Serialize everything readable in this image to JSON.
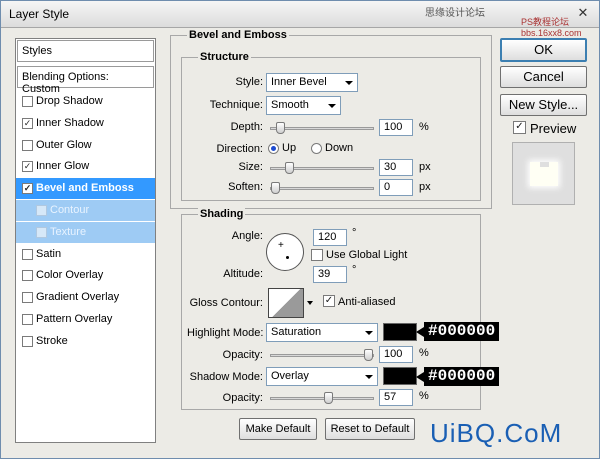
{
  "window": {
    "title": "Layer Style",
    "watermark_top": "思缘设计论坛",
    "watermark_top2": "PS教程论坛 bbs.16xx8.com",
    "watermark_bottom": "UiBQ.CoM"
  },
  "styles_panel": {
    "header": "Styles",
    "blending_options": "Blending Options: Custom",
    "items": [
      {
        "label": "Drop Shadow",
        "checked": false
      },
      {
        "label": "Inner Shadow",
        "checked": true
      },
      {
        "label": "Outer Glow",
        "checked": false
      },
      {
        "label": "Inner Glow",
        "checked": true
      },
      {
        "label": "Bevel and Emboss",
        "checked": true,
        "selected": true
      },
      {
        "label": "Contour",
        "checked": false,
        "sub": true
      },
      {
        "label": "Texture",
        "checked": false,
        "sub": true
      },
      {
        "label": "Satin",
        "checked": false
      },
      {
        "label": "Color Overlay",
        "checked": false
      },
      {
        "label": "Gradient Overlay",
        "checked": false
      },
      {
        "label": "Pattern Overlay",
        "checked": false
      },
      {
        "label": "Stroke",
        "checked": false
      }
    ]
  },
  "bevel": {
    "group_title": "Bevel and Emboss",
    "structure": {
      "title": "Structure",
      "style_label": "Style:",
      "style_value": "Inner Bevel",
      "technique_label": "Technique:",
      "technique_value": "Smooth",
      "depth_label": "Depth:",
      "depth_value": "100",
      "depth_unit": "%",
      "depth_level": 0.05,
      "direction_label": "Direction:",
      "direction_up": "Up",
      "direction_down": "Down",
      "direction_selected": "up",
      "size_label": "Size:",
      "size_value": "30",
      "size_unit": "px",
      "size_level": 0.15,
      "soften_label": "Soften:",
      "soften_value": "0",
      "soften_unit": "px",
      "soften_level": 0
    },
    "shading": {
      "title": "Shading",
      "angle_label": "Angle:",
      "angle_value": "120",
      "angle_unit": "°",
      "use_global_light": "Use Global Light",
      "use_global_light_checked": false,
      "altitude_label": "Altitude:",
      "altitude_value": "39",
      "altitude_unit": "°",
      "gloss_contour_label": "Gloss Contour:",
      "anti_aliased": "Anti-aliased",
      "anti_aliased_checked": true,
      "highlight_mode_label": "Highlight Mode:",
      "highlight_mode_value": "Saturation",
      "highlight_color": "#000000",
      "highlight_color_tag": "#000000",
      "highlight_opacity_label": "Opacity:",
      "highlight_opacity_value": "100",
      "highlight_opacity_unit": "%",
      "highlight_opacity_level": 1.0,
      "shadow_mode_label": "Shadow Mode:",
      "shadow_mode_value": "Overlay",
      "shadow_color": "#000000",
      "shadow_color_tag": "#000000",
      "shadow_opacity_label": "Opacity:",
      "shadow_opacity_value": "57",
      "shadow_opacity_unit": "%",
      "shadow_opacity_level": 0.57
    },
    "make_default": "Make Default",
    "reset_to_default": "Reset to Default"
  },
  "buttons": {
    "ok": "OK",
    "cancel": "Cancel",
    "new_style": "New Style...",
    "preview": "Preview",
    "preview_checked": true
  }
}
